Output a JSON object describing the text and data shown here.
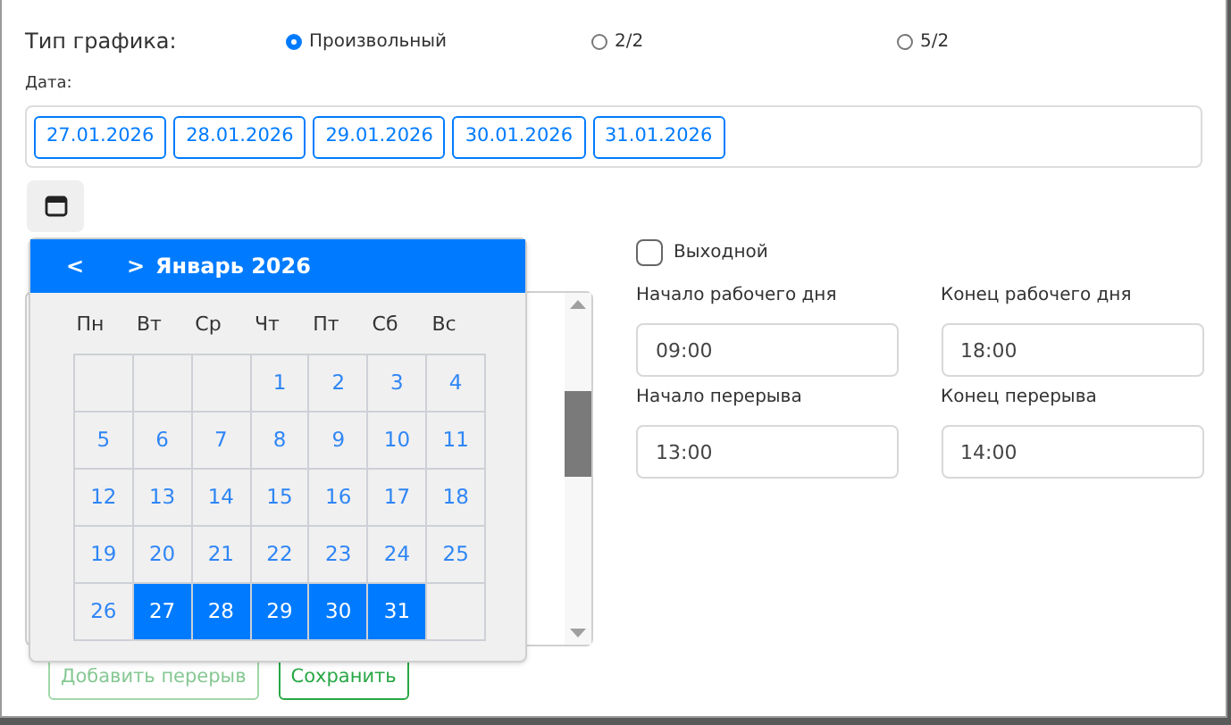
{
  "schedule_type": {
    "label": "Тип графика:",
    "options": [
      {
        "label": "Произвольный",
        "selected": true
      },
      {
        "label": "2/2",
        "selected": false
      },
      {
        "label": "5/2",
        "selected": false
      }
    ]
  },
  "dates": {
    "label": "Дата:",
    "items": [
      "27.01.2026",
      "28.01.2026",
      "29.01.2026",
      "30.01.2026",
      "31.01.2026"
    ]
  },
  "calendar": {
    "prev": "<",
    "next": ">",
    "title": "Январь 2026",
    "weekdays": [
      "Пн",
      "Вт",
      "Ср",
      "Чт",
      "Пт",
      "Сб",
      "Вс"
    ],
    "cells": [
      {
        "kind": "empty"
      },
      {
        "kind": "empty"
      },
      {
        "kind": "empty"
      },
      {
        "kind": "day",
        "day": "1",
        "selected": false
      },
      {
        "kind": "day",
        "day": "2",
        "selected": false
      },
      {
        "kind": "day",
        "day": "3",
        "selected": false
      },
      {
        "kind": "day",
        "day": "4",
        "selected": false
      },
      {
        "kind": "day",
        "day": "5",
        "selected": false
      },
      {
        "kind": "day",
        "day": "6",
        "selected": false
      },
      {
        "kind": "day",
        "day": "7",
        "selected": false
      },
      {
        "kind": "day",
        "day": "8",
        "selected": false
      },
      {
        "kind": "day",
        "day": "9",
        "selected": false
      },
      {
        "kind": "day",
        "day": "10",
        "selected": false
      },
      {
        "kind": "day",
        "day": "11",
        "selected": false
      },
      {
        "kind": "day",
        "day": "12",
        "selected": false
      },
      {
        "kind": "day",
        "day": "13",
        "selected": false
      },
      {
        "kind": "day",
        "day": "14",
        "selected": false
      },
      {
        "kind": "day",
        "day": "15",
        "selected": false
      },
      {
        "kind": "day",
        "day": "16",
        "selected": false
      },
      {
        "kind": "day",
        "day": "17",
        "selected": false
      },
      {
        "kind": "day",
        "day": "18",
        "selected": false
      },
      {
        "kind": "day",
        "day": "19",
        "selected": false
      },
      {
        "kind": "day",
        "day": "20",
        "selected": false
      },
      {
        "kind": "day",
        "day": "21",
        "selected": false
      },
      {
        "kind": "day",
        "day": "22",
        "selected": false
      },
      {
        "kind": "day",
        "day": "23",
        "selected": false
      },
      {
        "kind": "day",
        "day": "24",
        "selected": false
      },
      {
        "kind": "day",
        "day": "25",
        "selected": false
      },
      {
        "kind": "day",
        "day": "26",
        "selected": false
      },
      {
        "kind": "day",
        "day": "27",
        "selected": true
      },
      {
        "kind": "day",
        "day": "28",
        "selected": true
      },
      {
        "kind": "day",
        "day": "29",
        "selected": true
      },
      {
        "kind": "day",
        "day": "30",
        "selected": true
      },
      {
        "kind": "day",
        "day": "31",
        "selected": true
      },
      {
        "kind": "empty"
      }
    ]
  },
  "day_off": {
    "label": "Выходной",
    "checked": false
  },
  "fields": [
    {
      "label": "Начало рабочего дня",
      "value": "09:00"
    },
    {
      "label": "Конец рабочего дня",
      "value": "18:00"
    },
    {
      "label": "Начало перерыва",
      "value": "13:00"
    },
    {
      "label": "Конец перерыва",
      "value": "14:00"
    }
  ],
  "buttons": [
    {
      "label": "Добавить перерыв",
      "disabled": true
    },
    {
      "label": "Сохранить",
      "disabled": false
    }
  ]
}
